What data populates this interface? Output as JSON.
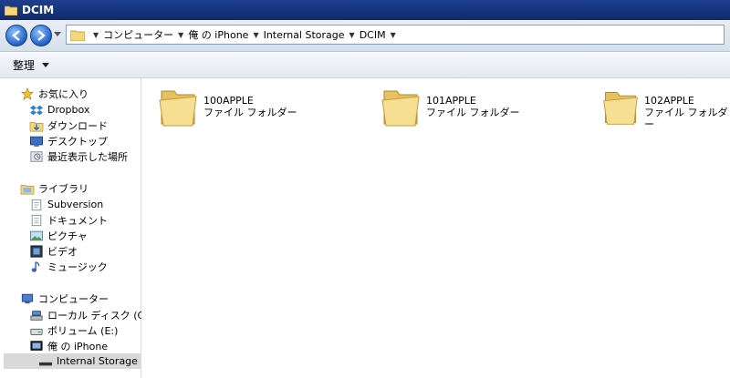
{
  "window": {
    "title": "DCIM"
  },
  "address": {
    "crumbs": [
      "コンピューター",
      "俺 の iPhone",
      "Internal Storage",
      "DCIM"
    ]
  },
  "toolbar": {
    "organize_label": "整理"
  },
  "nav": {
    "favorites": {
      "header": "お気に入り",
      "items": [
        "Dropbox",
        "ダウンロード",
        "デスクトップ",
        "最近表示した場所"
      ]
    },
    "libraries": {
      "header": "ライブラリ",
      "items": [
        "Subversion",
        "ドキュメント",
        "ピクチャ",
        "ビデオ",
        "ミュージック"
      ]
    },
    "computer": {
      "header": "コンピューター",
      "items": [
        "ローカル ディスク (C:)",
        "ボリューム (E:)",
        "俺 の iPhone",
        "Internal Storage"
      ]
    }
  },
  "content": {
    "folders": [
      {
        "name": "100APPLE",
        "type": "ファイル フォルダー"
      },
      {
        "name": "101APPLE",
        "type": "ファイル フォルダー"
      },
      {
        "name": "102APPLE",
        "type": "ファイル フォルダー"
      }
    ]
  },
  "colors": {
    "title_bar": "#1e3f8f",
    "folder": "#f3d77e",
    "selection": "#d9d9d9"
  }
}
